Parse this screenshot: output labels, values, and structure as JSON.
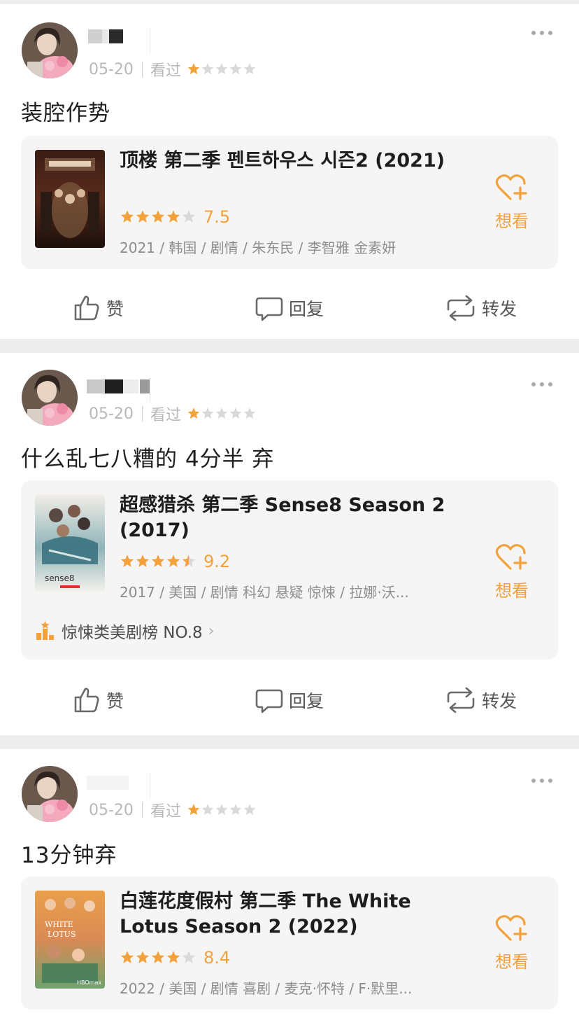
{
  "colors": {
    "accent": "#f2a13b",
    "star_empty": "#d9d9d9"
  },
  "posts": [
    {
      "date": "05-20",
      "status": "看过",
      "user_rating": 1,
      "comment": "装腔作势",
      "movie": {
        "title": "顶楼 第二季 펜트하우스 시즌2 (2021)",
        "rating_stars": 4,
        "score": "7.5",
        "info": "2021 / 韩国 / 剧情 / 朱东民 / 李智雅 金素妍",
        "want_label": "想看",
        "poster_icon": "penthouse-poster"
      },
      "actions": {
        "like": "赞",
        "reply": "回复",
        "repost": "转发"
      }
    },
    {
      "date": "05-20",
      "status": "看过",
      "user_rating": 1,
      "comment": "什么乱七八糟的 4分半 弃",
      "movie": {
        "title": "超感猎杀 第二季 Sense8 Season 2 (2017)",
        "rating_stars": 4.5,
        "score": "9.2",
        "info": "2017 / 美国 / 剧情 科幻 悬疑 惊悚 / 拉娜·沃...",
        "want_label": "想看",
        "poster_icon": "sense8-poster",
        "rank_label": "惊悚类美剧榜 NO.8"
      },
      "actions": {
        "like": "赞",
        "reply": "回复",
        "repost": "转发"
      }
    },
    {
      "date": "05-20",
      "status": "看过",
      "user_rating": 1,
      "comment": "13分钟弃",
      "movie": {
        "title": "白莲花度假村 第二季 The White Lotus Season 2 (2022)",
        "rating_stars": 4,
        "score": "8.4",
        "info": "2022 / 美国 / 剧情 喜剧 / 麦克·怀特 / F·默里...",
        "want_label": "想看",
        "poster_icon": "white-lotus-poster"
      },
      "actions": {
        "like": "赞",
        "reply": "回复",
        "repost": "转发"
      }
    }
  ]
}
